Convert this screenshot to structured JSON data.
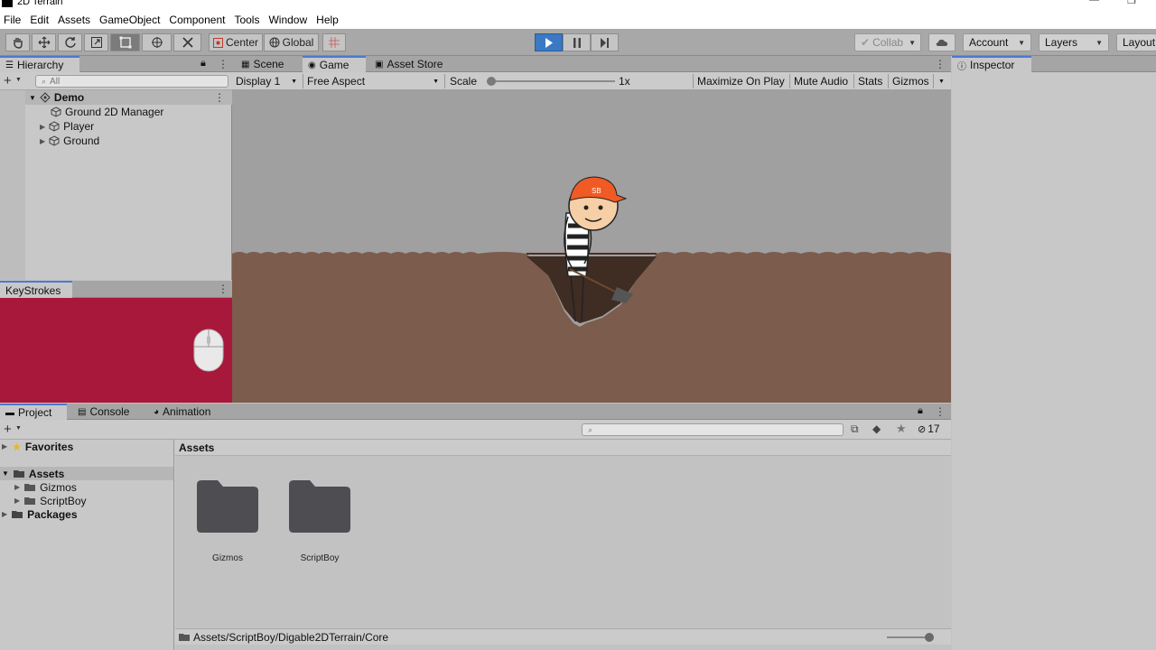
{
  "window": {
    "title": "2D Terrain"
  },
  "menu": [
    "File",
    "Edit",
    "Assets",
    "GameObject",
    "Component",
    "Tools",
    "Window",
    "Help"
  ],
  "toolbar": {
    "pivot_label": "Center",
    "space_label": "Global",
    "collab_label": "Collab",
    "account_label": "Account",
    "layers_label": "Layers",
    "layout_label": "Layout"
  },
  "hierarchy": {
    "tab_label": "Hierarchy",
    "search_placeholder": "All",
    "scene_name": "Demo",
    "items": [
      {
        "label": "Ground 2D Manager",
        "expandable": false
      },
      {
        "label": "Player",
        "expandable": true
      },
      {
        "label": "Ground",
        "expandable": true
      }
    ]
  },
  "keystrokes": {
    "tab_label": "KeyStrokes"
  },
  "center_tabs": [
    {
      "label": "Scene",
      "icon": "scene-icon",
      "selected": false
    },
    {
      "label": "Game",
      "icon": "game-icon",
      "selected": true
    },
    {
      "label": "Asset Store",
      "icon": "store-icon",
      "selected": false
    }
  ],
  "game": {
    "display": "Display 1",
    "aspect": "Free Aspect",
    "scale_label": "Scale",
    "scale_value": "1x",
    "maximize_label": "Maximize On Play",
    "mute_label": "Mute Audio",
    "stats_label": "Stats",
    "gizmos_label": "Gizmos",
    "cap_text": "SB"
  },
  "inspector": {
    "tab_label": "Inspector"
  },
  "project": {
    "tabs": [
      {
        "label": "Project",
        "selected": true
      },
      {
        "label": "Console",
        "selected": false
      },
      {
        "label": "Animation",
        "selected": false
      }
    ],
    "hidden_count": "17",
    "tree": {
      "favorites": "Favorites",
      "assets": "Assets",
      "children": [
        "Gizmos",
        "ScriptBoy"
      ],
      "packages": "Packages"
    },
    "assets_header": "Assets",
    "folders": [
      "Gizmos",
      "ScriptBoy"
    ],
    "path": "Assets/ScriptBoy/Digable2DTerrain/Core"
  },
  "colors": {
    "accent": "#3b79c4",
    "keystrokes_bg": "#a8183a",
    "dirt": "#7b5c4d",
    "cap": "#f05a24"
  }
}
